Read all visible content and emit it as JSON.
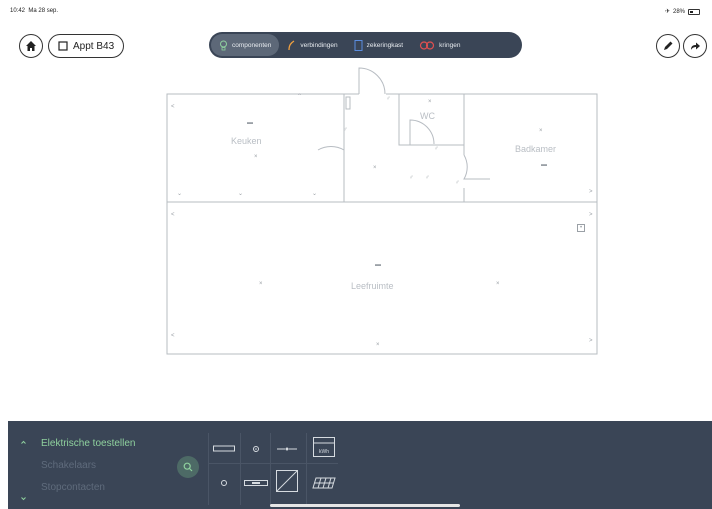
{
  "status_bar": {
    "time": "10:42",
    "date": "Ma 28 sep.",
    "battery": "28%"
  },
  "header": {
    "apartment_label": "Appt B43"
  },
  "segments": [
    {
      "label": "componenten",
      "icon": "bulb-icon",
      "color": "#8fd19e"
    },
    {
      "label": "verbindingen",
      "icon": "wire-icon",
      "color": "#f0a040"
    },
    {
      "label": "zekeringkast",
      "icon": "fusebox-icon",
      "color": "#5b8de0"
    },
    {
      "label": "kringen",
      "icon": "circuits-icon",
      "color": "#e05050"
    }
  ],
  "rooms": {
    "keuken": "Keuken",
    "wc": "WC",
    "badkamer": "Badkamer",
    "leefruimte": "Leefruimte"
  },
  "panel": {
    "categories": [
      "Elektrische toestellen",
      "Schakelaars",
      "Stopcontacten"
    ],
    "mini_label": "kWh"
  },
  "colors": {
    "panel_bg": "#3a4556",
    "accent_green": "#8fd19e"
  }
}
